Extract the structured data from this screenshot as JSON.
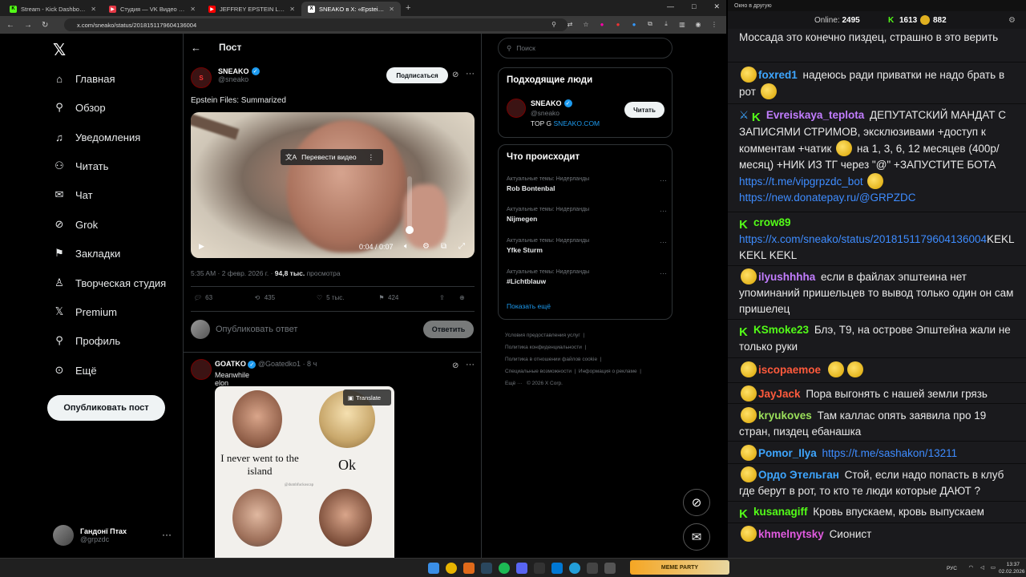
{
  "browser": {
    "tabs": [
      {
        "title": "Stream - Kick Dashboard",
        "fav_color": "#53fc18",
        "fav_glyph": "K"
      },
      {
        "title": "Студия — VK Видео Live",
        "fav_color": "#e63946",
        "fav_glyph": "▶"
      },
      {
        "title": "JEFFREY EPSTEIN LAST INTERVI",
        "fav_color": "#ff0000",
        "fav_glyph": "▶"
      },
      {
        "title": "SNEAKO в X: «Epstein Files: Sum",
        "fav_color": "#ffffff",
        "fav_glyph": "X"
      }
    ],
    "new_tab": "+",
    "url": "x.com/sneako/status/2018151179604136004",
    "window_controls": [
      "—",
      "□",
      "✕"
    ]
  },
  "x_nav": {
    "logo": "𝕏",
    "items": [
      {
        "label": "Главная",
        "icon": "home-icon",
        "glyph": "⌂"
      },
      {
        "label": "Обзор",
        "icon": "search-icon",
        "glyph": "⚲"
      },
      {
        "label": "Уведомления",
        "icon": "bell-icon",
        "glyph": "🔔︎"
      },
      {
        "label": "Читать",
        "icon": "follow-icon",
        "glyph": "👤︎"
      },
      {
        "label": "Чат",
        "icon": "mail-icon",
        "glyph": "✉"
      },
      {
        "label": "Grok",
        "icon": "grok-icon",
        "glyph": "⊘"
      },
      {
        "label": "Закладки",
        "icon": "bookmark-icon",
        "glyph": "🔖︎"
      },
      {
        "label": "Творческая студия",
        "icon": "studio-icon",
        "glyph": "♙"
      },
      {
        "label": "Premium",
        "icon": "x-premium-icon",
        "glyph": "𝕏"
      },
      {
        "label": "Профиль",
        "icon": "profile-icon",
        "glyph": "👤︎"
      },
      {
        "label": "Ещё",
        "icon": "more-circle-icon",
        "glyph": "⋯"
      }
    ],
    "post_button": "Опубликовать пост",
    "me": {
      "name": "Гандонї Птах",
      "handle": "@grpzdc"
    }
  },
  "post": {
    "header": "Пост",
    "author_name": "SNEAKO",
    "author_handle": "@sneako",
    "subscribe": "Подписаться",
    "text": "Epstein Files: Summarized",
    "video": {
      "translate": "Перевести видео",
      "time": "0:04 / 0:07",
      "volume": 0.05
    },
    "meta_time": "5:35 AM · 2 февр. 2026 г. ·",
    "meta_views": "94,8 тыс.",
    "meta_views_label": "просмотра",
    "stats": {
      "replies": "63",
      "reposts": "435",
      "likes": "5 тыс.",
      "bookmarks": "424"
    },
    "reply_placeholder": "Опубликовать ответ",
    "reply_button": "Ответить"
  },
  "reply_tweet": {
    "name": "GOATKO",
    "handle": "@Goatedko1",
    "age": "· 8 ч",
    "text": "Meanwhile elon",
    "translate": "Translate",
    "cap1": "I never went to the island",
    "cap2": "Ok",
    "watermark": "@dumbfuckoscap"
  },
  "sidebar": {
    "search_placeholder": "Поиск",
    "people_title": "Подходящие люди",
    "person": {
      "name": "SNEAKO",
      "handle": "@sneako",
      "bio": "TOP G",
      "bio_link": "SNEAKO.COM",
      "follow": "Читать"
    },
    "trends_title": "Что происходит",
    "trends": [
      {
        "cat": "Актуальные темы: Нидерланды",
        "name": "Rob Bontenbal"
      },
      {
        "cat": "Актуальные темы: Нидерланды",
        "name": "Nijmegen"
      },
      {
        "cat": "Актуальные темы: Нидерланды",
        "name": "Yfke Sturm"
      },
      {
        "cat": "Актуальные темы: Нидерланды",
        "name": "#Lichtblauw"
      }
    ],
    "show_more": "Показать ещё",
    "footer": [
      "Условия предоставления услуг",
      "Политика конфиденциальности",
      "Политика в отношении файлов cookie",
      "Специальные возможности",
      "Информация о рекламе",
      "Ещё ···",
      "© 2026 X Corp."
    ]
  },
  "chat": {
    "window_title": "Окно в другую",
    "online_label": "Online:",
    "online": "2495",
    "kick_count": "1613",
    "emote_count": "882",
    "messages": [
      {
        "user": "",
        "color": "#e8e8e8",
        "text": "Моссада это конечно пиздец, страшно в это верить"
      },
      {
        "user": "foxred1",
        "color": "#3ea6ff",
        "text": "надеюсь ради приватки не надо брать в рот"
      },
      {
        "user": "Evreiskaya_teplota",
        "color": "#c27dff",
        "text": "ДЕПУТАТСКИЙ МАНДАТ С ЗАПИСЯМИ СТРИМОВ, эксклюзивами +доступ к комментам +чатик",
        "text2": "на 1, 3, 6, 12 месяцев (400р/месяц) +НИК ИЗ ТГ через \"@\" +ЗАПУСТИТЕ БОТА",
        "link": "https://t.me/vipgrpzdc_bot",
        "link2": "https://new.donatepay.ru/@GRPZDC"
      },
      {
        "user": "crow89",
        "color": "#53fc18",
        "link": "https://x.com/sneako/status/2018151179604136004",
        "text": "KEKL KEKL KEKL"
      },
      {
        "user": "ilyushhhha",
        "color": "#c27dff",
        "text": "если в файлах эпштеина нет упоминаний пришельцев то вывод только один он сам пришелец"
      },
      {
        "user": "KSmoke23",
        "color": "#53fc18",
        "text": "Блэ, Т9, на острове Эпштейна жали не только руки"
      },
      {
        "user": "iscopaemoe",
        "color": "#ff5a3c",
        "text": ""
      },
      {
        "user": "JayJack",
        "color": "#ff5a3c",
        "text": "Пора выгонять с нашей земли грязь"
      },
      {
        "user": "kryukoves",
        "color": "#9be05a",
        "text": "Там каллас опять заявила про 19 стран, пиздец ебанашка"
      },
      {
        "user": "Pomor_Ilya",
        "color": "#3ea6ff",
        "link": "https://t.me/sashakon/13211",
        "text": ""
      },
      {
        "user": "Ордо Этельган",
        "color": "#3ea6ff",
        "text": "Стой, если надо попасть в клуб где берут в рот, то кто те люди которые ДАЮТ ?"
      },
      {
        "user": "kusanagiff",
        "color": "#53fc18",
        "text": "Кровь впускаем, кровь выпускаем"
      },
      {
        "user": "khmelnytsky",
        "color": "#e05adf",
        "text": "Сионист"
      }
    ]
  },
  "taskbar": {
    "lang": "РУС",
    "time": "13:37",
    "date": "02.02.2026",
    "meme_party": "MEME PARTY"
  }
}
